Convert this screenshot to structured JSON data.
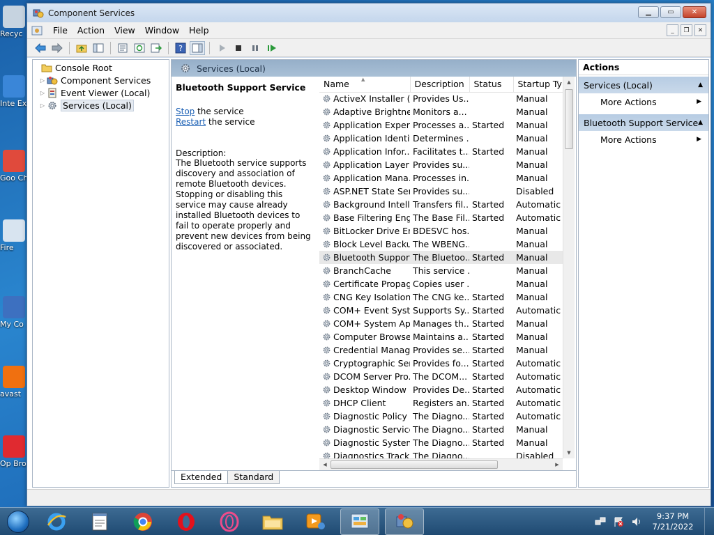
{
  "desktop": {
    "icons": [
      {
        "caption": "Recyc",
        "top": 0
      },
      {
        "caption": "Inte Exp",
        "top": 0
      },
      {
        "caption": "Goo Chr",
        "top": 0
      },
      {
        "caption": "Fire",
        "top": 0
      },
      {
        "caption": "My Co",
        "top": 0
      },
      {
        "caption": "avast",
        "top": 0
      },
      {
        "caption": "Op Bro",
        "top": 0
      }
    ]
  },
  "window": {
    "title": "Component Services",
    "menu": [
      "File",
      "Action",
      "View",
      "Window",
      "Help"
    ]
  },
  "tree": {
    "root": "Console Root",
    "items": [
      "Component Services",
      "Event Viewer (Local)",
      "Services (Local)"
    ]
  },
  "middle": {
    "header": "Services (Local)",
    "selected_service": "Bluetooth Support Service",
    "stop_link": "Stop",
    "stop_rest": " the service",
    "restart_link": "Restart",
    "restart_rest": " the service",
    "description_label": "Description:",
    "description": "The Bluetooth service supports discovery and association of remote Bluetooth devices.  Stopping or disabling this service may cause already installed Bluetooth devices to fail to operate properly and prevent new devices from being discovered or associated.",
    "columns": [
      "Name",
      "Description",
      "Status",
      "Startup Type"
    ],
    "rows": [
      [
        "ActiveX Installer (...",
        "Provides Us...",
        "",
        "Manual"
      ],
      [
        "Adaptive Brightness",
        "Monitors a...",
        "",
        "Manual"
      ],
      [
        "Application Experi...",
        "Processes a...",
        "Started",
        "Manual"
      ],
      [
        "Application Identity",
        "Determines ...",
        "",
        "Manual"
      ],
      [
        "Application Infor...",
        "Facilitates t...",
        "Started",
        "Manual"
      ],
      [
        "Application Layer ...",
        "Provides su...",
        "",
        "Manual"
      ],
      [
        "Application Mana...",
        "Processes in...",
        "",
        "Manual"
      ],
      [
        "ASP.NET State Ser...",
        "Provides su...",
        "",
        "Disabled"
      ],
      [
        "Background Intelli...",
        "Transfers fil...",
        "Started",
        "Automatic ("
      ],
      [
        "Base Filtering Engi...",
        "The Base Fil...",
        "Started",
        "Automatic"
      ],
      [
        "BitLocker Drive En...",
        "BDESVC hos...",
        "",
        "Manual"
      ],
      [
        "Block Level Backu...",
        "The WBENG...",
        "",
        "Manual"
      ],
      [
        "Bluetooth Support...",
        "The Bluetoo...",
        "Started",
        "Manual"
      ],
      [
        "BranchCache",
        "This service ...",
        "",
        "Manual"
      ],
      [
        "Certificate Propag...",
        "Copies user ...",
        "",
        "Manual"
      ],
      [
        "CNG Key Isolation",
        "The CNG ke...",
        "Started",
        "Manual"
      ],
      [
        "COM+ Event Syst...",
        "Supports Sy...",
        "Started",
        "Automatic"
      ],
      [
        "COM+ System Ap...",
        "Manages th...",
        "Started",
        "Manual"
      ],
      [
        "Computer Browser",
        "Maintains a...",
        "Started",
        "Manual"
      ],
      [
        "Credential Manager",
        "Provides se...",
        "Started",
        "Manual"
      ],
      [
        "Cryptographic Ser...",
        "Provides fo...",
        "Started",
        "Automatic"
      ],
      [
        "DCOM Server Pro...",
        "The DCOM...",
        "Started",
        "Automatic"
      ],
      [
        "Desktop Window ...",
        "Provides De...",
        "Started",
        "Automatic"
      ],
      [
        "DHCP Client",
        "Registers an...",
        "Started",
        "Automatic"
      ],
      [
        "Diagnostic Policy ...",
        "The Diagno...",
        "Started",
        "Automatic"
      ],
      [
        "Diagnostic Service...",
        "The Diagno...",
        "Started",
        "Manual"
      ],
      [
        "Diagnostic System...",
        "The Diagno...",
        "Started",
        "Manual"
      ],
      [
        "Diagnostics Tracki...",
        "The Diagno...",
        "",
        "Disabled"
      ]
    ],
    "selected_row": 12,
    "tabs": [
      "Extended",
      "Standard"
    ]
  },
  "actions": {
    "title": "Actions",
    "sections": [
      {
        "label": "Services (Local)",
        "item": "More Actions"
      },
      {
        "label": "Bluetooth Support Service",
        "item": "More Actions"
      }
    ]
  },
  "taskbar": {
    "time": "9:37 PM",
    "date": "7/21/2022"
  },
  "colors": {
    "header_blue": "#a9c0d6",
    "link": "#1a5fb4",
    "taskbar": "#1f4a72"
  }
}
